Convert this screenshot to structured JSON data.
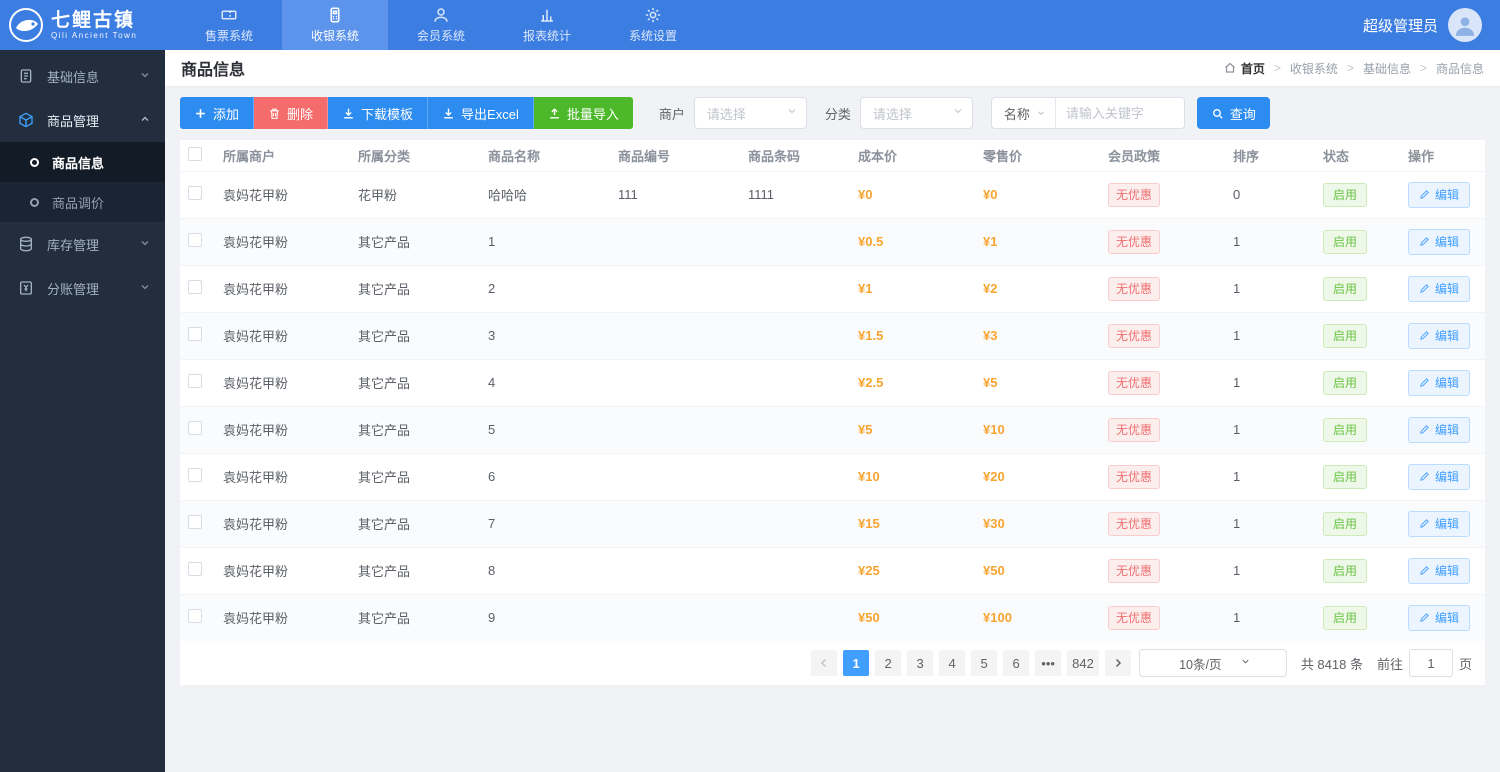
{
  "topbar": {
    "logo_title": "七鲤古镇",
    "logo_subtitle": "Qili Ancient Town",
    "user_name": "超级管理员",
    "tabs": [
      {
        "label": "售票系统",
        "icon": "ticket-icon"
      },
      {
        "label": "收银系统",
        "icon": "cashier-icon"
      },
      {
        "label": "会员系统",
        "icon": "member-icon"
      },
      {
        "label": "报表统计",
        "icon": "report-icon"
      },
      {
        "label": "系统设置",
        "icon": "settings-icon"
      }
    ]
  },
  "sidebar": {
    "items": [
      {
        "label": "基础信息",
        "icon": "document-icon",
        "expanded": false
      },
      {
        "label": "商品管理",
        "icon": "cube-icon",
        "expanded": true,
        "children": [
          {
            "label": "商品信息",
            "active": true
          },
          {
            "label": "商品调价",
            "active": false
          }
        ]
      },
      {
        "label": "库存管理",
        "icon": "inventory-icon",
        "expanded": false
      },
      {
        "label": "分账管理",
        "icon": "ledger-icon",
        "expanded": false
      }
    ]
  },
  "page": {
    "title": "商品信息",
    "breadcrumb": [
      "首页",
      "收银系统",
      "基础信息",
      "商品信息"
    ]
  },
  "toolbar": {
    "add_label": "添加",
    "delete_label": "删除",
    "download_template_label": "下载模板",
    "export_excel_label": "导出Excel",
    "batch_import_label": "批量导入"
  },
  "filters": {
    "merchant_label": "商户",
    "merchant_placeholder": "请选择",
    "category_label": "分类",
    "category_placeholder": "请选择",
    "name_label": "名称",
    "keyword_placeholder": "请输入关键字",
    "search_label": "查询"
  },
  "table": {
    "headers": [
      "所属商户",
      "所属分类",
      "商品名称",
      "商品编号",
      "商品条码",
      "成本价",
      "零售价",
      "会员政策",
      "排序",
      "状态",
      "操作"
    ],
    "rows": [
      {
        "merchant": "袁妈花甲粉",
        "category": "花甲粉",
        "name": "哈哈哈",
        "number": "111",
        "barcode": "1111",
        "cost": "¥0",
        "retail": "¥0",
        "policy": "无优惠",
        "sort": "0",
        "status": "启用",
        "action": "编辑"
      },
      {
        "merchant": "袁妈花甲粉",
        "category": "其它产品",
        "name": "1",
        "number": "",
        "barcode": "",
        "cost": "¥0.5",
        "retail": "¥1",
        "policy": "无优惠",
        "sort": "1",
        "status": "启用",
        "action": "编辑"
      },
      {
        "merchant": "袁妈花甲粉",
        "category": "其它产品",
        "name": "2",
        "number": "",
        "barcode": "",
        "cost": "¥1",
        "retail": "¥2",
        "policy": "无优惠",
        "sort": "1",
        "status": "启用",
        "action": "编辑"
      },
      {
        "merchant": "袁妈花甲粉",
        "category": "其它产品",
        "name": "3",
        "number": "",
        "barcode": "",
        "cost": "¥1.5",
        "retail": "¥3",
        "policy": "无优惠",
        "sort": "1",
        "status": "启用",
        "action": "编辑"
      },
      {
        "merchant": "袁妈花甲粉",
        "category": "其它产品",
        "name": "4",
        "number": "",
        "barcode": "",
        "cost": "¥2.5",
        "retail": "¥5",
        "policy": "无优惠",
        "sort": "1",
        "status": "启用",
        "action": "编辑"
      },
      {
        "merchant": "袁妈花甲粉",
        "category": "其它产品",
        "name": "5",
        "number": "",
        "barcode": "",
        "cost": "¥5",
        "retail": "¥10",
        "policy": "无优惠",
        "sort": "1",
        "status": "启用",
        "action": "编辑"
      },
      {
        "merchant": "袁妈花甲粉",
        "category": "其它产品",
        "name": "6",
        "number": "",
        "barcode": "",
        "cost": "¥10",
        "retail": "¥20",
        "policy": "无优惠",
        "sort": "1",
        "status": "启用",
        "action": "编辑"
      },
      {
        "merchant": "袁妈花甲粉",
        "category": "其它产品",
        "name": "7",
        "number": "",
        "barcode": "",
        "cost": "¥15",
        "retail": "¥30",
        "policy": "无优惠",
        "sort": "1",
        "status": "启用",
        "action": "编辑"
      },
      {
        "merchant": "袁妈花甲粉",
        "category": "其它产品",
        "name": "8",
        "number": "",
        "barcode": "",
        "cost": "¥25",
        "retail": "¥50",
        "policy": "无优惠",
        "sort": "1",
        "status": "启用",
        "action": "编辑"
      },
      {
        "merchant": "袁妈花甲粉",
        "category": "其它产品",
        "name": "9",
        "number": "",
        "barcode": "",
        "cost": "¥50",
        "retail": "¥100",
        "policy": "无优惠",
        "sort": "1",
        "status": "启用",
        "action": "编辑"
      }
    ]
  },
  "pagination": {
    "pages": [
      "1",
      "2",
      "3",
      "4",
      "5",
      "6",
      "...",
      "842"
    ],
    "active_page": "1",
    "page_size": "10条/页",
    "total": "共 8418 条",
    "goto_label": "前往",
    "goto_value": "1",
    "goto_suffix": "页"
  },
  "colors": {
    "topbar_blue": "#3c7de2",
    "accent_blue": "#409eff",
    "button_blue": "#2d8cf0",
    "danger_red": "#f56c6c",
    "success_green": "#4cb82a",
    "price_orange": "#f8a430",
    "sidebar_dark": "#222e3e"
  }
}
